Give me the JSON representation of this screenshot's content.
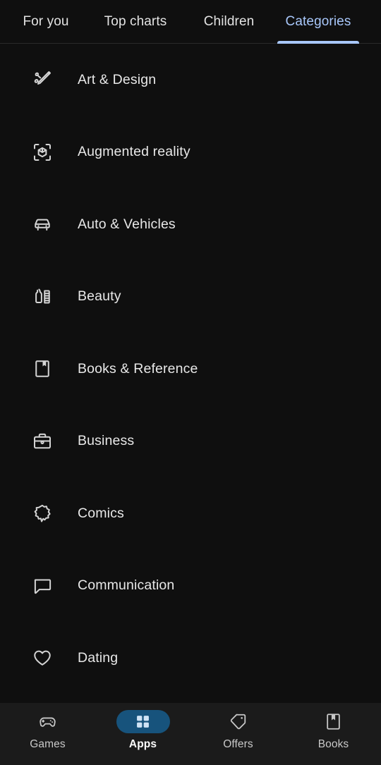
{
  "tabs": [
    {
      "label": "For you",
      "active": false
    },
    {
      "label": "Top charts",
      "active": false
    },
    {
      "label": "Children",
      "active": false
    },
    {
      "label": "Categories",
      "active": true
    }
  ],
  "categories": [
    {
      "label": "Art & Design",
      "icon": "art-design-icon"
    },
    {
      "label": "Augmented reality",
      "icon": "augmented-reality-icon"
    },
    {
      "label": "Auto & Vehicles",
      "icon": "car-icon"
    },
    {
      "label": "Beauty",
      "icon": "beauty-icon"
    },
    {
      "label": "Books & Reference",
      "icon": "book-bookmark-icon"
    },
    {
      "label": "Business",
      "icon": "briefcase-icon"
    },
    {
      "label": "Comics",
      "icon": "comics-burst-icon"
    },
    {
      "label": "Communication",
      "icon": "chat-bubble-icon"
    },
    {
      "label": "Dating",
      "icon": "heart-icon"
    }
  ],
  "bottom_nav": [
    {
      "label": "Games",
      "icon": "gamepad-icon",
      "active": false
    },
    {
      "label": "Apps",
      "icon": "apps-grid-icon",
      "active": true
    },
    {
      "label": "Offers",
      "icon": "price-tag-icon",
      "active": false
    },
    {
      "label": "Books",
      "icon": "book-marker-icon",
      "active": false
    }
  ],
  "colors": {
    "background": "#0f0f0f",
    "bottom_nav_background": "#1b1b1b",
    "accent": "#a8c7fa",
    "active_pill": "#17537c",
    "text_primary": "#e8e8e8",
    "divider": "#2a2a2a"
  }
}
